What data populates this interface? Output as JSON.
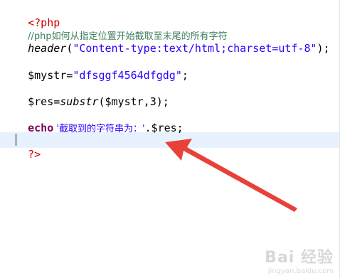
{
  "editor": {
    "line1_open_tag": "<?php",
    "line2_comment": "//php如何从指定位置开始截取至末尾的所有字符",
    "line3_func": "header",
    "line3_paren_open": "(",
    "line3_string": "\"Content-type:text/html;charset=utf-8\"",
    "line3_paren_close": ");",
    "line5_var": "$mystr=",
    "line5_string": "\"dfsggf4564dfgdg\"",
    "line5_end": ";",
    "line7_var": "$res=",
    "line7_func": "substr",
    "line7_args": "($mystr,3);",
    "line9_keyword": "echo",
    "line9_string": " '截取到的字符串为：'",
    "line9_rest": ".$res;",
    "line11_close_tag": "?>"
  },
  "watermark": {
    "main": "Bai 经验",
    "sub": "jingyan.baidu.com"
  },
  "colors": {
    "tag": "#cc0000",
    "comment": "#3f7f5f",
    "string": "#2a00ff",
    "keyword": "#7f0055",
    "arrow": "#e8413a",
    "current_line": "#e8f2fe"
  },
  "icons": {
    "annotation_arrow": "red-arrow-icon"
  }
}
